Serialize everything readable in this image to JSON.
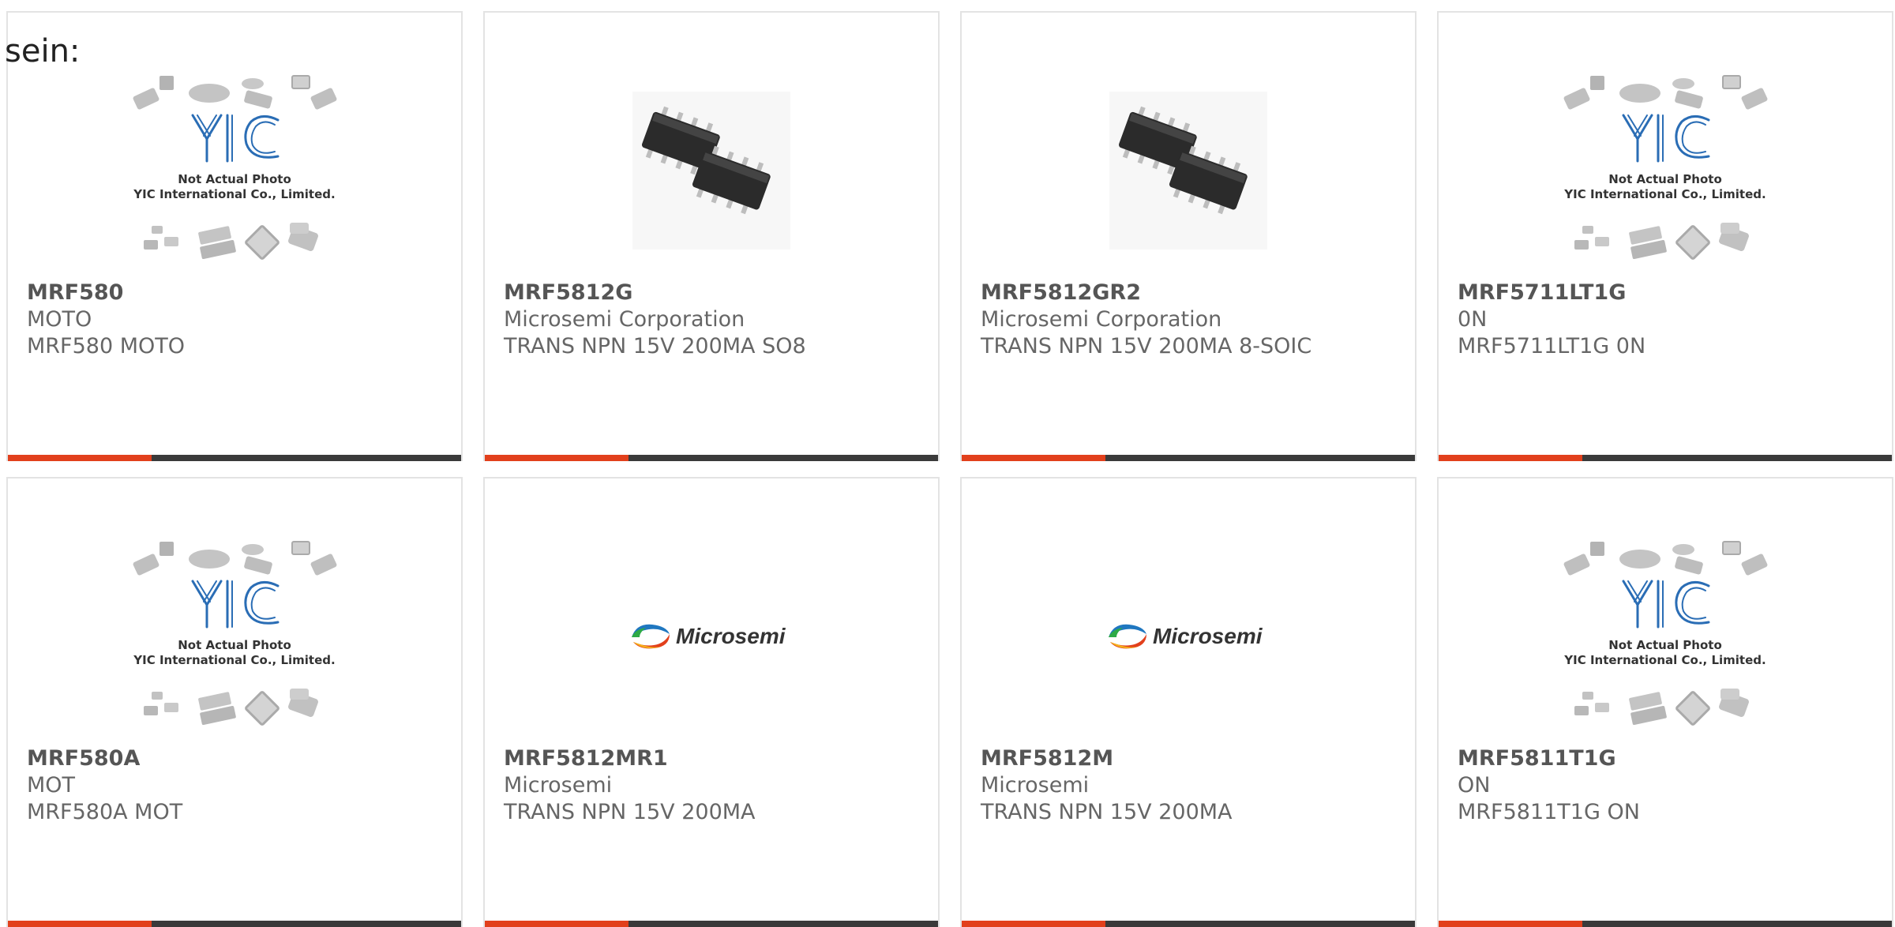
{
  "intro_text": "sein:",
  "colors": {
    "accent": "#e2401c",
    "bar": "#3a3a3a",
    "border": "#e3e3e3",
    "text": "#666666"
  },
  "placeholder_logo": {
    "brand": "YIC",
    "line1": "Not Actual Photo",
    "line2": "YIC International Co., Limited."
  },
  "microsemi_logo": {
    "brand": "Microsemi"
  },
  "products": [
    {
      "part": "MRF580",
      "maker": "MOTO",
      "desc": "MRF580 MOTO",
      "image": "yic-placeholder"
    },
    {
      "part": "MRF5812G",
      "maker": "Microsemi Corporation",
      "desc": "TRANS NPN 15V 200MA SO8",
      "image": "soic-chips"
    },
    {
      "part": "MRF5812GR2",
      "maker": "Microsemi Corporation",
      "desc": "TRANS NPN 15V 200MA 8-SOIC",
      "image": "soic-chips"
    },
    {
      "part": "MRF5711LT1G",
      "maker": "0N",
      "desc": "MRF5711LT1G 0N",
      "image": "yic-placeholder"
    },
    {
      "part": "MRF580A",
      "maker": "MOT",
      "desc": "MRF580A MOT",
      "image": "yic-placeholder"
    },
    {
      "part": "MRF5812MR1",
      "maker": "Microsemi",
      "desc": "TRANS NPN 15V 200MA",
      "image": "microsemi-logo"
    },
    {
      "part": "MRF5812M",
      "maker": "Microsemi",
      "desc": "TRANS NPN 15V 200MA",
      "image": "microsemi-logo"
    },
    {
      "part": "MRF5811T1G",
      "maker": "ON",
      "desc": "MRF5811T1G ON",
      "image": "yic-placeholder"
    }
  ]
}
